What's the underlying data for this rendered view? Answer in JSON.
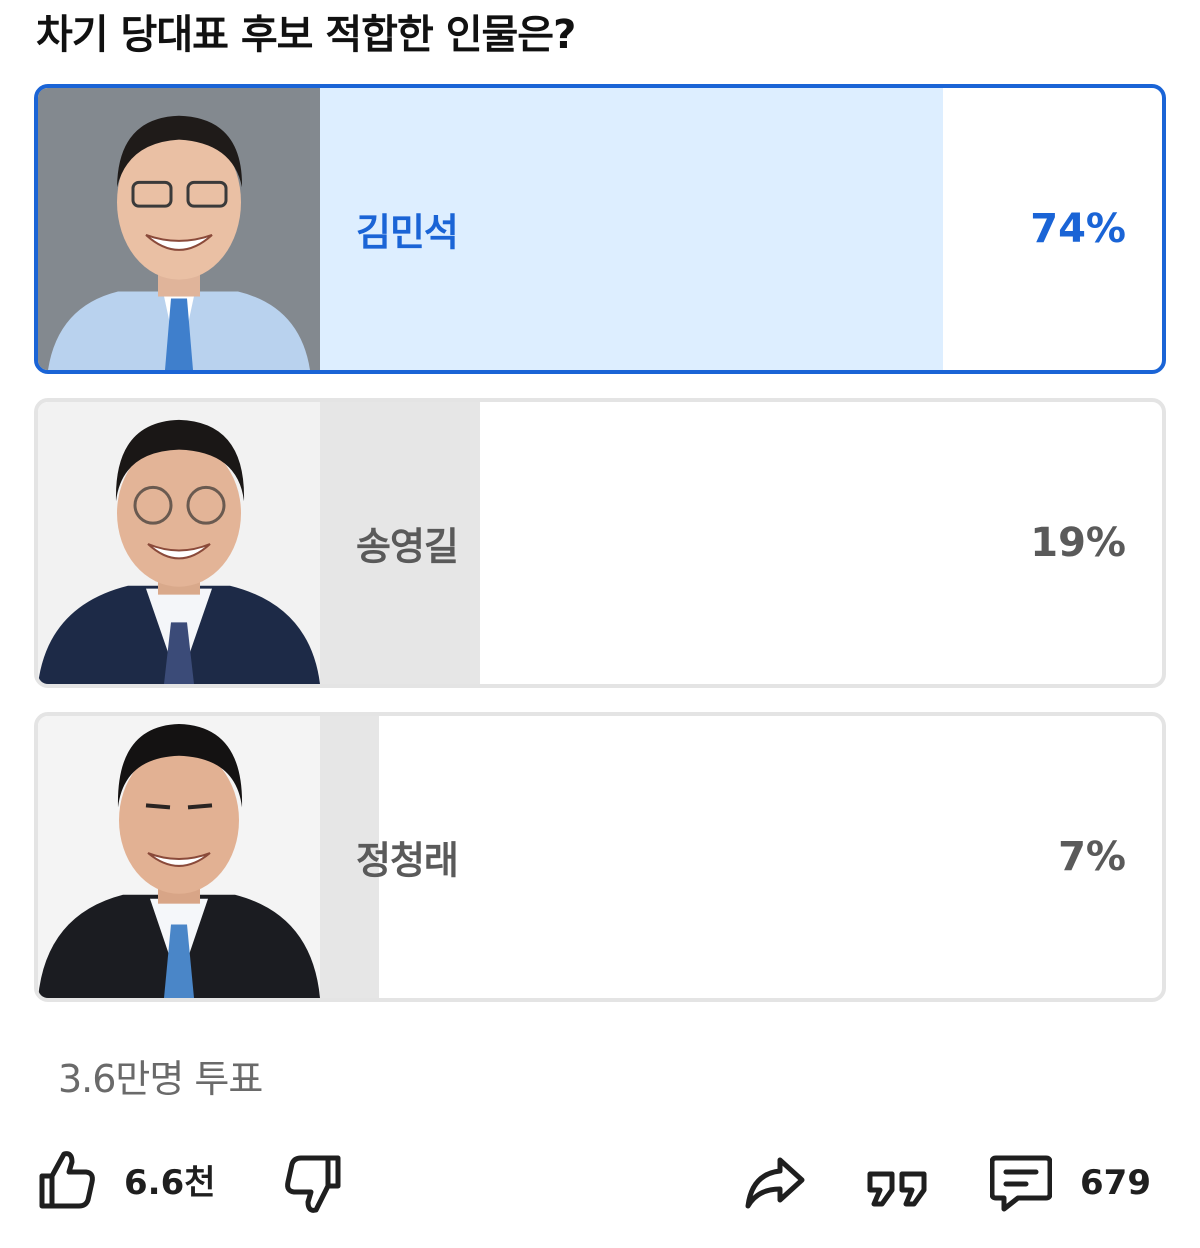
{
  "poll": {
    "title": "차기 당대표 후보 적합한 인물은?",
    "options": [
      {
        "name": "김민석",
        "percent_label": "74%",
        "percent": 74,
        "selected": true
      },
      {
        "name": "송영길",
        "percent_label": "19%",
        "percent": 19,
        "selected": false
      },
      {
        "name": "정청래",
        "percent_label": "7%",
        "percent": 7,
        "selected": false
      }
    ],
    "vote_count": "3.6만명 투표"
  },
  "actions": {
    "like_count": "6.6천",
    "comment_count": "679"
  },
  "colors": {
    "accent": "#1a64d6",
    "selected_fill": "#ddeeff",
    "unselected_fill": "#e6e6e6",
    "border": "#e4e4e4"
  },
  "icons": [
    "thumbs-up-icon",
    "thumbs-down-icon",
    "share-icon",
    "quote-icon",
    "comment-icon"
  ]
}
